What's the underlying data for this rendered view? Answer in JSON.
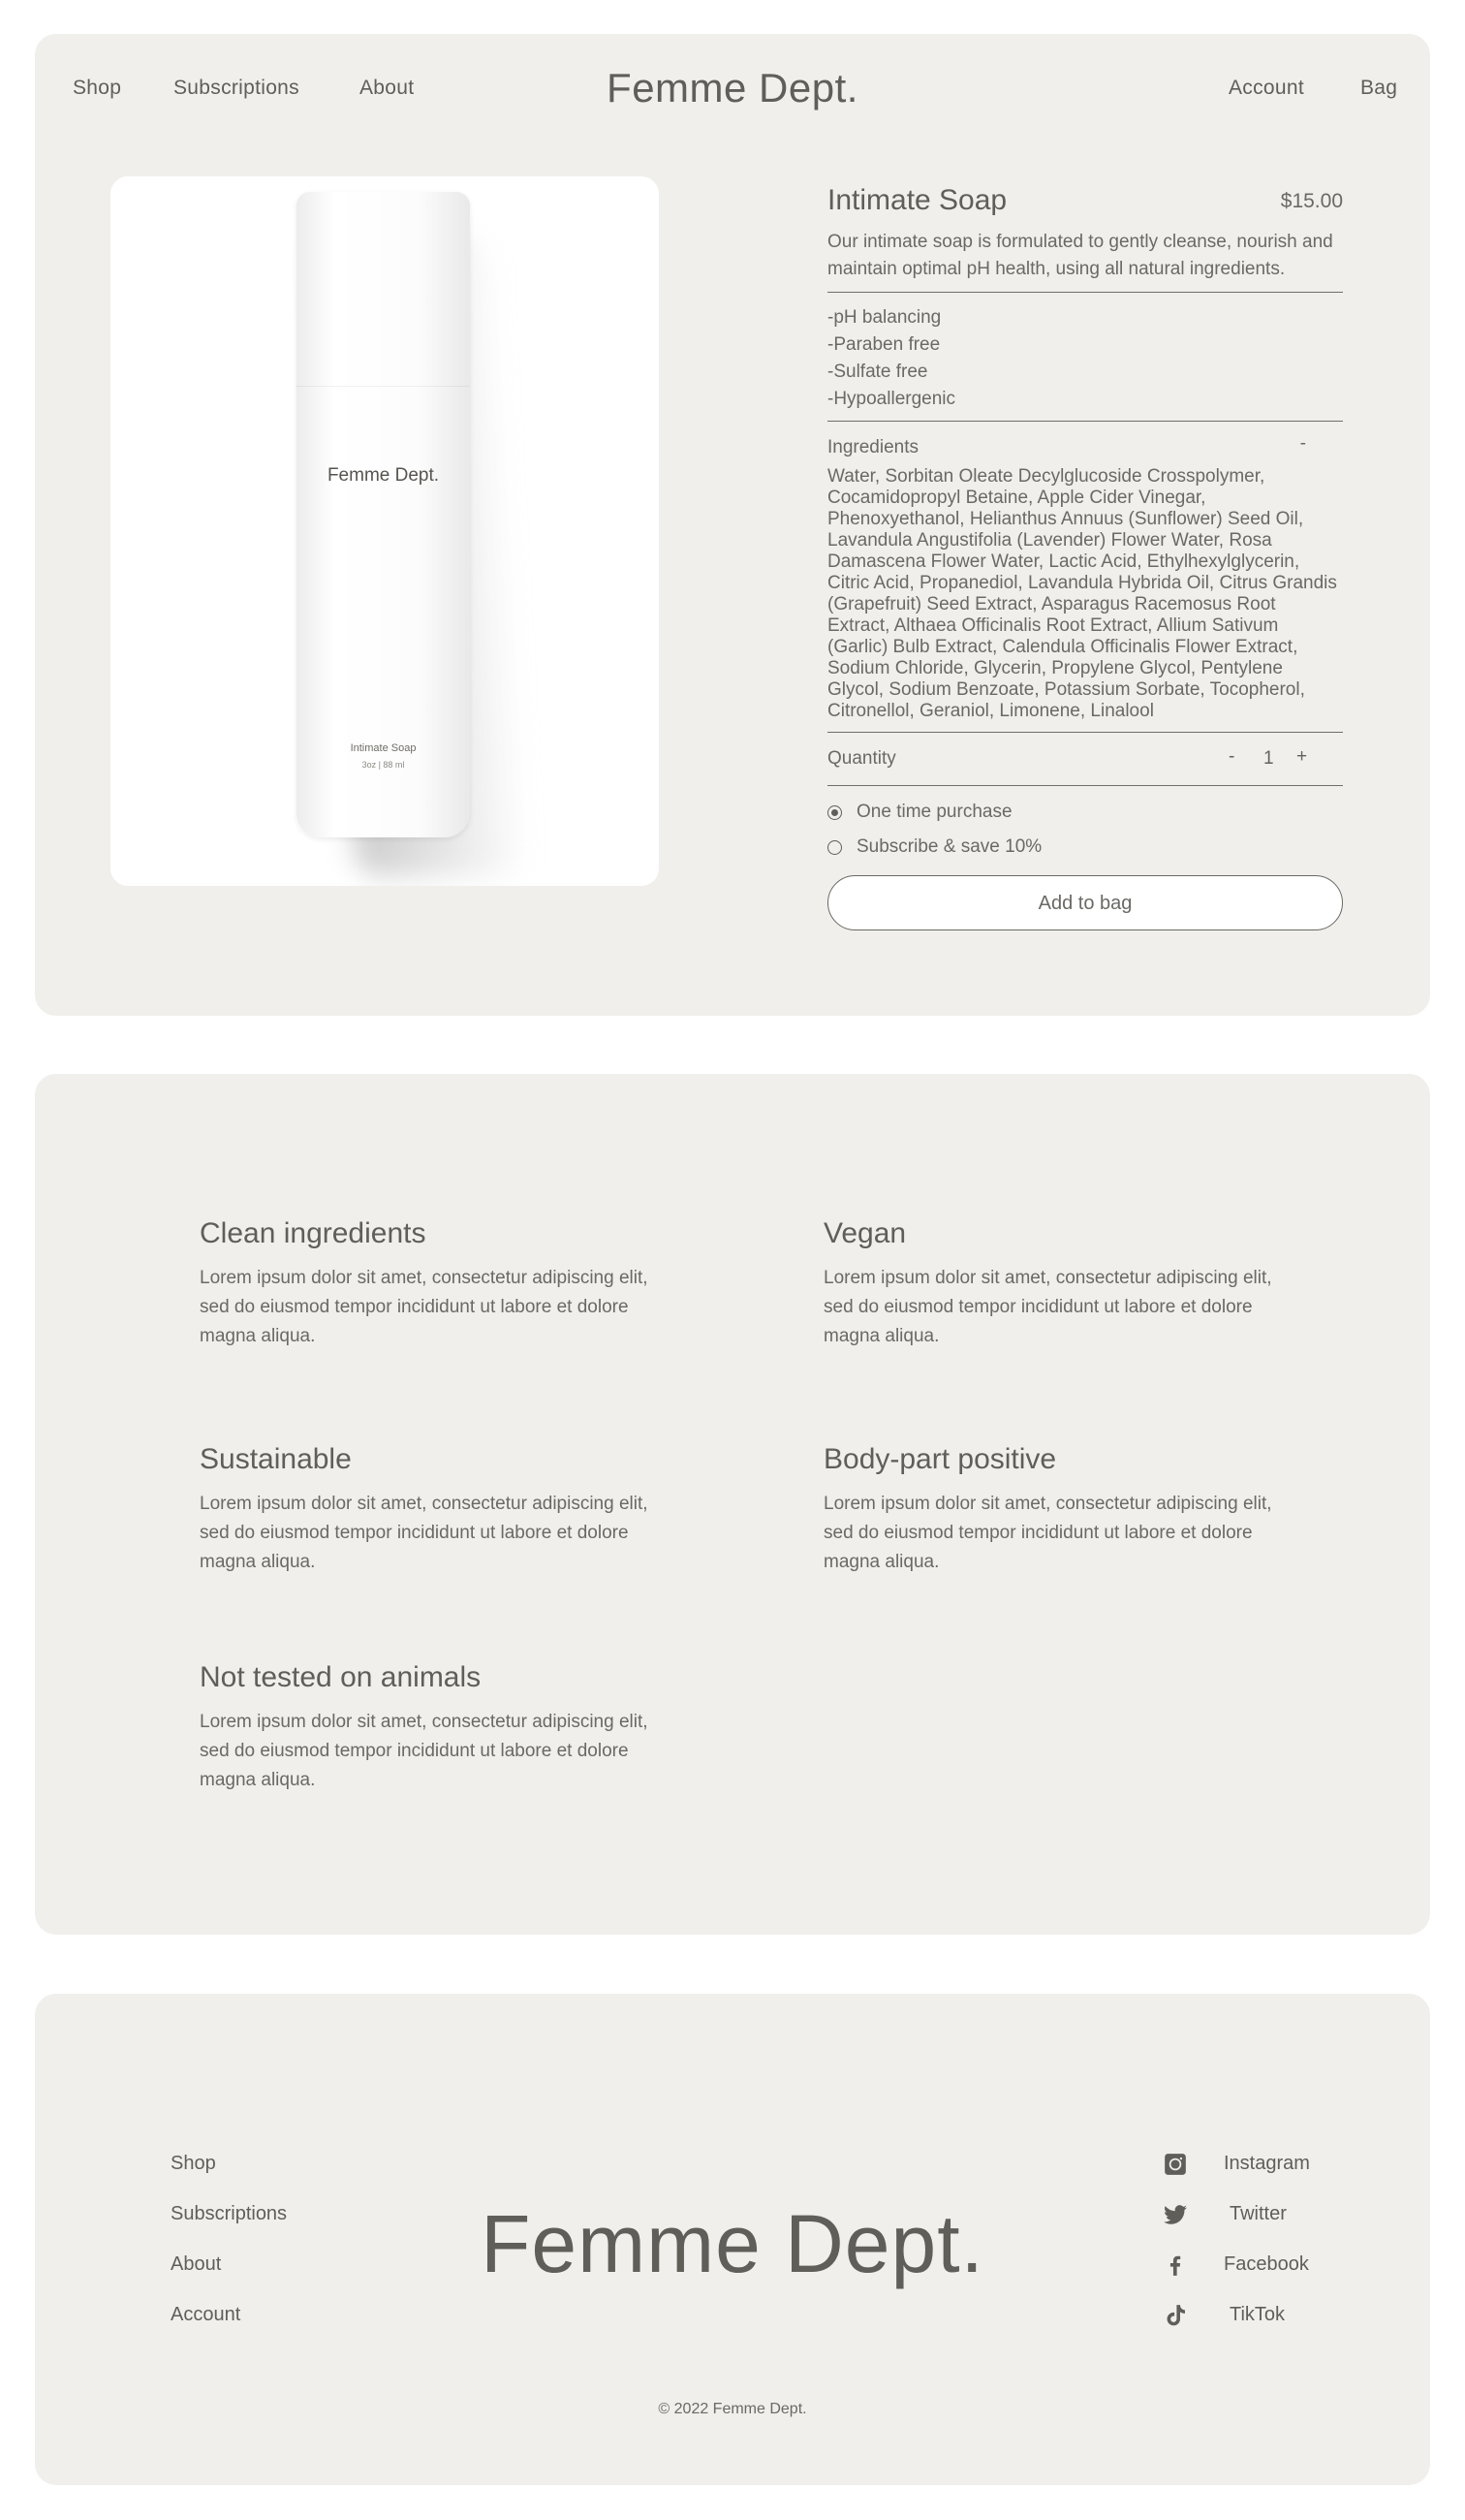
{
  "header": {
    "nav_left": [
      "Shop",
      "Subscriptions",
      "About"
    ],
    "brand": "Femme Dept.",
    "nav_right": [
      "Account",
      "Bag"
    ]
  },
  "product_image": {
    "bottle_brand": "Femme Dept.",
    "bottle_name": "Intimate Soap",
    "bottle_size": "3oz | 88 ml"
  },
  "product": {
    "title": "Intimate Soap",
    "price": "$15.00",
    "description": "Our intimate soap is formulated to gently cleanse, nourish and maintain optimal pH health, using all natural ingredients.",
    "benefits": [
      "-pH balancing",
      "-Paraben free",
      "-Sulfate free",
      "-Hypoallergenic"
    ],
    "ingredients_label": "Ingredients",
    "ingredients_toggle": "-",
    "ingredients": "Water, Sorbitan Oleate Decylglucoside Crosspolymer, Cocamidopropyl Betaine, Apple Cider Vinegar, Phenoxyethanol, Helianthus Annuus (Sunflower) Seed Oil, Lavandula Angustifolia (Lavender) Flower Water, Rosa Damascena Flower Water, Lactic Acid, Ethylhexylglycerin, Citric Acid, Propanediol, Lavandula Hybrida Oil, Citrus Grandis (Grapefruit) Seed Extract, Asparagus Racemosus Root Extract, Althaea Officinalis Root Extract, Allium Sativum (Garlic) Bulb Extract, Calendula Officinalis Flower Extract, Sodium Chloride, Glycerin, Propylene Glycol, Pentylene Glycol, Sodium Benzoate, Potassium Sorbate, Tocopherol, Citronellol, Geraniol, Limonene, Linalool",
    "quantity_label": "Quantity",
    "quantity_minus": "-",
    "quantity_value": "1",
    "quantity_plus": "+",
    "purchase_options": [
      "One time purchase",
      "Subscribe & save 10%"
    ],
    "selected_option": "One time purchase",
    "add_to_bag": "Add to bag"
  },
  "features": [
    {
      "title": "Clean ingredients",
      "text": "Lorem ipsum dolor sit amet, consectetur adipiscing elit, sed do eiusmod tempor incididunt ut labore et dolore magna aliqua."
    },
    {
      "title": "Vegan",
      "text": "Lorem ipsum dolor sit amet, consectetur adipiscing elit, sed do eiusmod tempor incididunt ut labore et dolore magna aliqua."
    },
    {
      "title": "Sustainable",
      "text": "Lorem ipsum dolor sit amet, consectetur adipiscing elit, sed do eiusmod tempor incididunt ut labore et dolore magna aliqua."
    },
    {
      "title": "Body-part positive",
      "text": "Lorem ipsum dolor sit amet, consectetur adipiscing elit, sed do eiusmod tempor incididunt ut labore et dolore magna aliqua."
    },
    {
      "title": "Not tested on animals",
      "text": "Lorem ipsum dolor sit amet, consectetur adipiscing elit, sed do eiusmod tempor incididunt ut labore et dolore magna aliqua."
    }
  ],
  "footer": {
    "links": [
      "Shop",
      "Subscriptions",
      "About",
      "Account"
    ],
    "brand": "Femme Dept.",
    "social": [
      {
        "label": "Instagram",
        "icon": "instagram-icon"
      },
      {
        "label": "Twitter",
        "icon": "twitter-icon"
      },
      {
        "label": "Facebook",
        "icon": "facebook-icon"
      },
      {
        "label": "TikTok",
        "icon": "tiktok-icon"
      }
    ],
    "copyright": "© 2022 Femme Dept."
  },
  "colors": {
    "panel": "#f0efeb",
    "text": "#5f5e59",
    "page": "#ffffff"
  }
}
